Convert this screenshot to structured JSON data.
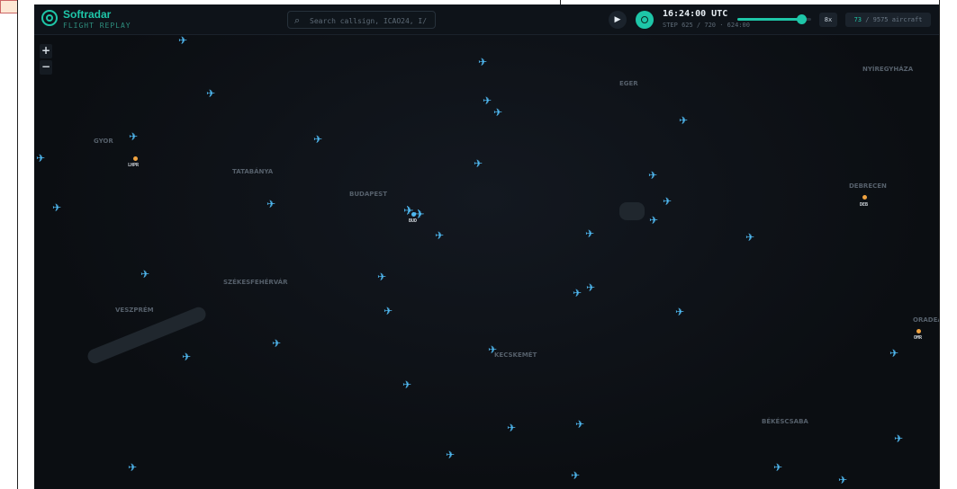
{
  "app": {
    "brand": "Softradar",
    "subtitle": "FLIGHT REPLAY"
  },
  "search": {
    "placeholder": "Search callsign, ICAO24, I/"
  },
  "controls": {
    "play_icon": "play-icon",
    "live_icon": "target-icon",
    "time": "16:24:00 UTC",
    "step": "STEP 625 / 720 · 624:00",
    "progress": 0.87,
    "speed": "8x",
    "aircraft_visible": "73",
    "aircraft_total": "/ 9575 aircraft"
  },
  "zoom": {
    "in": "+",
    "out": "−"
  },
  "map": {
    "cities": [
      "GYOR",
      "BUDAPEST",
      "DEBRECEN",
      "SZÉKESFEHÉRVÁR",
      "KECSKEMÉT",
      "VESZPRÉM",
      "TATABÁNYA",
      "NYÍREGYHÁZA",
      "BÉKÉSCSABA",
      "ORADEA",
      "EGER"
    ],
    "airports": [
      "LHPR",
      "BUD",
      "DEB",
      "OMR"
    ],
    "colors": {
      "plane": "#4fb8f0",
      "accent": "#1ec6a8",
      "airport": "#f0a340"
    }
  }
}
